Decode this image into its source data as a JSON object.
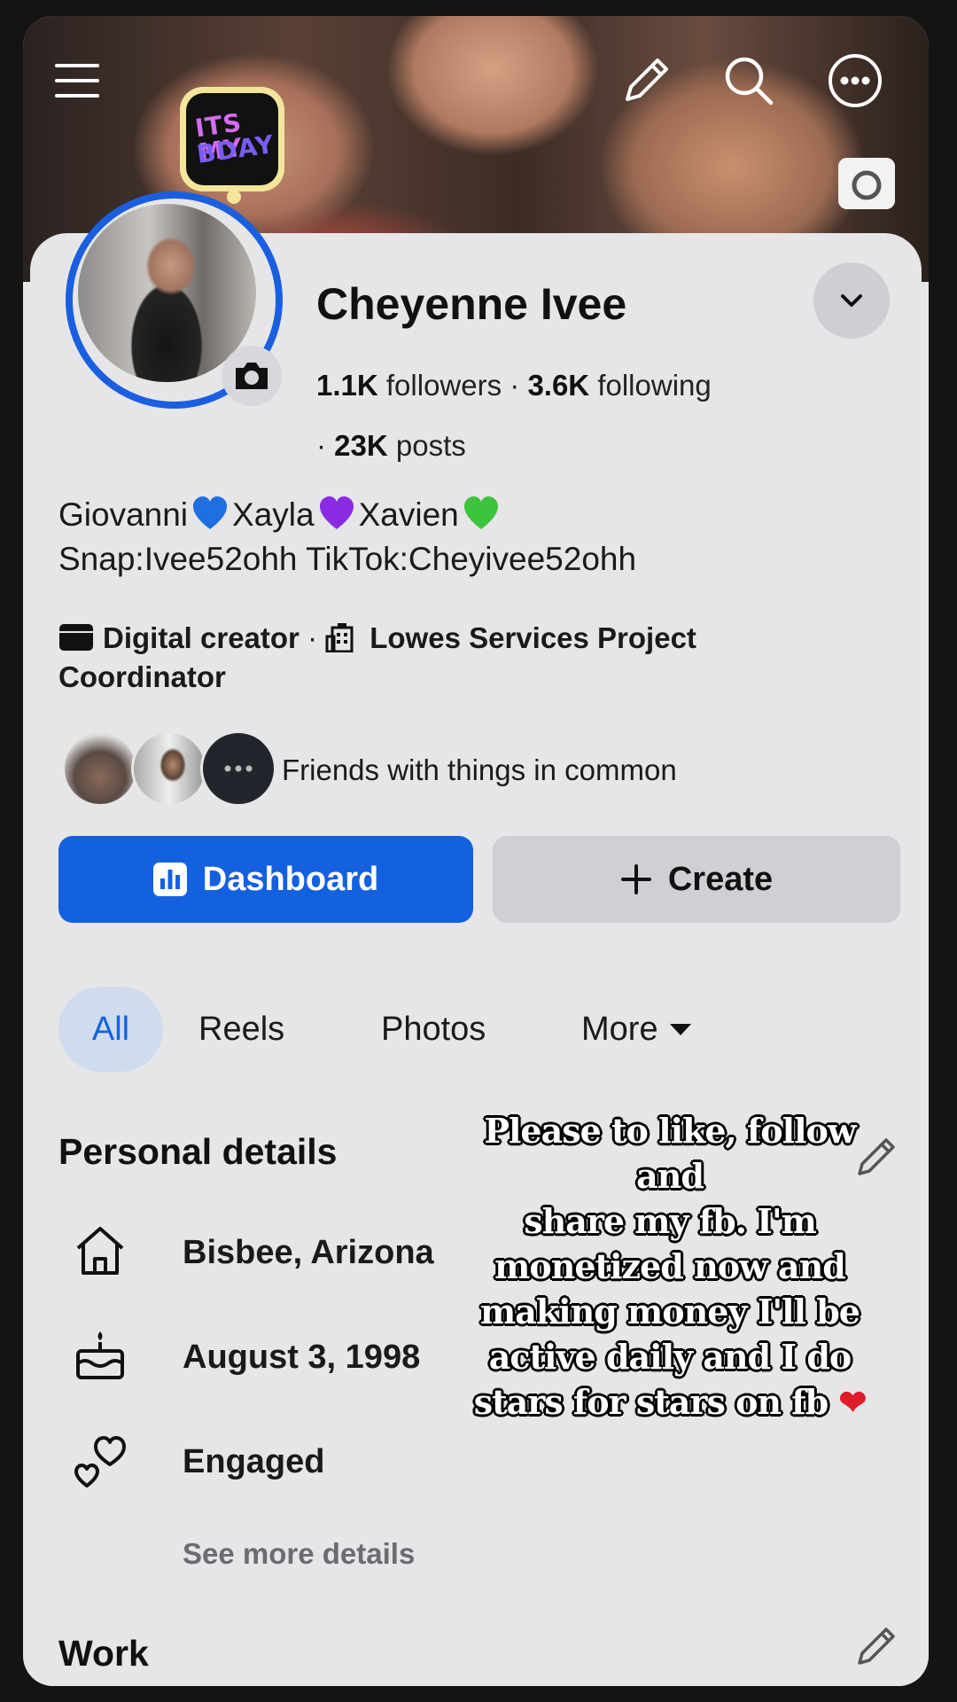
{
  "profile": {
    "name": "Cheyenne Ivee",
    "followers_count": "1.1K",
    "followers_label": " followers",
    "following_count": "3.6K",
    "following_label": " following",
    "posts_count": "23K",
    "posts_label": " posts",
    "separator": " · "
  },
  "story_badge_text": [
    "ITS MY",
    "BDAY"
  ],
  "bio": {
    "names": [
      "Giovanni",
      "Xayla",
      "Xavien"
    ],
    "heart_colors": [
      "#1f6fe0",
      "#8a2be2",
      "#3cc43c"
    ],
    "line2": "Snap:Ivee52ohh TikTok:Cheyivee52ohh"
  },
  "info": {
    "category": "Digital creator",
    "separator": " · ",
    "work": "Lowes Services Project Coordinator"
  },
  "friends_text": "Friends with things in common",
  "buttons": {
    "dashboard": "Dashboard",
    "create": "Create"
  },
  "tabs": {
    "all": "All",
    "reels": "Reels",
    "photos": "Photos",
    "more": "More"
  },
  "personal_details": {
    "title": "Personal details",
    "location": "Bisbee, Arizona",
    "birthday": "August 3, 1998",
    "relationship": "Engaged",
    "see_more": "See more details"
  },
  "work_title": "Work",
  "overlay_caption": {
    "lines": [
      "Please to like, follow and",
      "share my fb. I'm",
      "monetized now and",
      "making money I'll be",
      "active daily and I do",
      "stars for stars on fb"
    ],
    "heart": "❤"
  },
  "colors": {
    "accent": "#1461df",
    "ring": "#1a5fe0",
    "tab_active_bg": "#cfdcee"
  }
}
